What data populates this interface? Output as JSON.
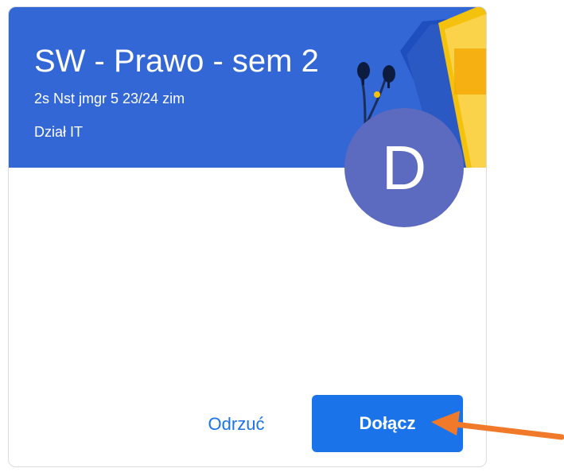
{
  "class_card": {
    "title": "SW - Prawo - sem 2",
    "section": "2s Nst jmgr 5 23/24 zim",
    "owner": "Dział IT",
    "avatar_letter": "D",
    "banner_color": "#3367d6",
    "avatar_color": "#5c6bc0"
  },
  "actions": {
    "decline_label": "Odrzuć",
    "join_label": "Dołącz",
    "accent_color": "#1a73e8"
  },
  "annotation": {
    "arrow_color": "#f07a2a",
    "icon": "arrow-left-icon"
  }
}
